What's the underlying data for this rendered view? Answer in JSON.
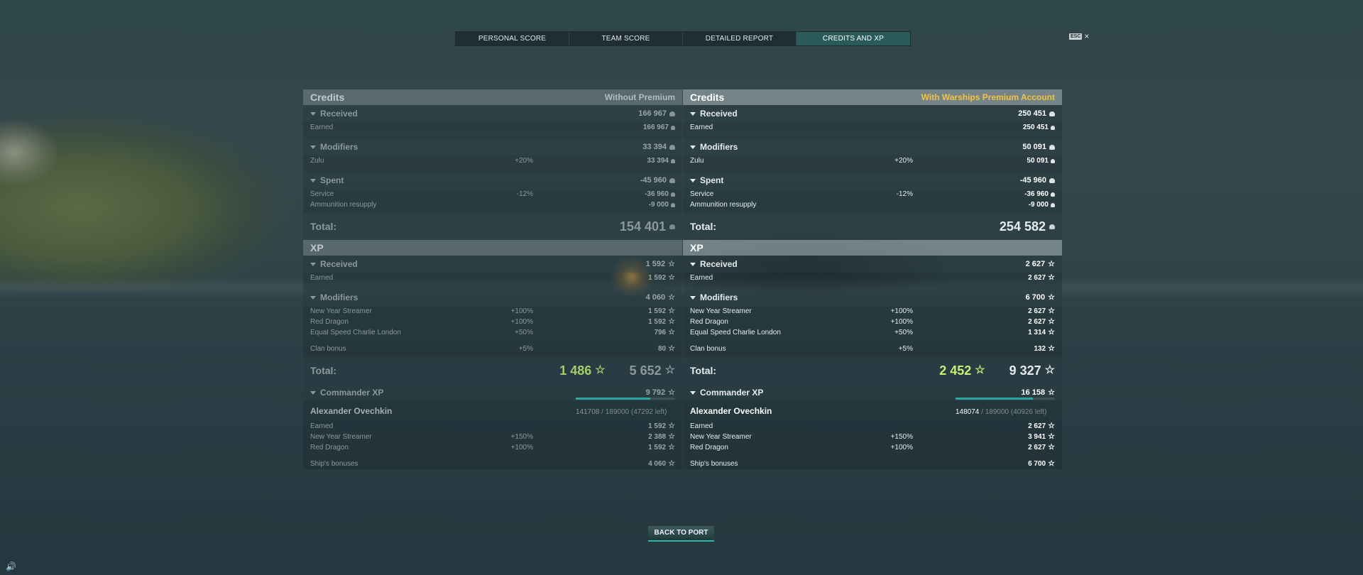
{
  "tabs": {
    "personal": "PERSONAL SCORE",
    "team": "TEAM SCORE",
    "detailed": "DETAILED REPORT",
    "credits_xp": "CREDITS AND XP"
  },
  "esc": {
    "key": "ESC",
    "close": "×"
  },
  "left": {
    "credits_title": "Credits",
    "badge": "Without Premium",
    "received": {
      "label": "Received",
      "amount": "166 967"
    },
    "earned": {
      "label": "Earned",
      "amount": "166 967"
    },
    "modifiers": {
      "label": "Modifiers",
      "amount": "33 394"
    },
    "zulu": {
      "label": "Zulu",
      "pct": "+20%",
      "amount": "33 394"
    },
    "spent": {
      "label": "Spent",
      "amount": "-45 960"
    },
    "service": {
      "label": "Service",
      "pct": "-12%",
      "amount": "-36 960"
    },
    "ammo": {
      "label": "Ammunition resupply",
      "amount": "-9 000"
    },
    "total_label": "Total:",
    "total_credits": "154 401",
    "xp_title": "XP",
    "xp_received": {
      "label": "Received",
      "amount": "1 592"
    },
    "xp_earned": {
      "label": "Earned",
      "amount": "1 592"
    },
    "xp_modifiers": {
      "label": "Modifiers",
      "amount": "4 060"
    },
    "nys": {
      "label": "New Year Streamer",
      "pct": "+100%",
      "amount": "1 592"
    },
    "rd": {
      "label": "Red Dragon",
      "pct": "+100%",
      "amount": "1 592"
    },
    "escl": {
      "label": "Equal Speed Charlie London",
      "pct": "+50%",
      "amount": "796"
    },
    "clan": {
      "label": "Clan bonus",
      "pct": "+5%",
      "amount": "80"
    },
    "xp_total_label": "Total:",
    "xp_total_free": "1 486",
    "xp_total": "5 652",
    "cmd": {
      "label": "Commander XP",
      "amount": "9 792"
    },
    "commander": {
      "name": "Alexander Ovechkin",
      "current": "141708",
      "rest": "/ 189000 (47292 left)",
      "progress": 0.75
    },
    "cmd_earned": {
      "label": "Earned",
      "amount": "1 592"
    },
    "cmd_nys": {
      "label": "New Year Streamer",
      "pct": "+150%",
      "amount": "2 388"
    },
    "cmd_rd": {
      "label": "Red Dragon",
      "pct": "+100%",
      "amount": "1 592"
    },
    "ship_bonus": {
      "label": "Ship's bonuses",
      "amount": "4 060"
    }
  },
  "right": {
    "credits_title": "Credits",
    "badge": "With Warships Premium Account",
    "received": {
      "label": "Received",
      "amount": "250 451"
    },
    "earned": {
      "label": "Earned",
      "amount": "250 451"
    },
    "modifiers": {
      "label": "Modifiers",
      "amount": "50 091"
    },
    "zulu": {
      "label": "Zulu",
      "pct": "+20%",
      "amount": "50 091"
    },
    "spent": {
      "label": "Spent",
      "amount": "-45 960"
    },
    "service": {
      "label": "Service",
      "pct": "-12%",
      "amount": "-36 960"
    },
    "ammo": {
      "label": "Ammunition resupply",
      "amount": "-9 000"
    },
    "total_label": "Total:",
    "total_credits": "254 582",
    "xp_title": "XP",
    "xp_received": {
      "label": "Received",
      "amount": "2 627"
    },
    "xp_earned": {
      "label": "Earned",
      "amount": "2 627"
    },
    "xp_modifiers": {
      "label": "Modifiers",
      "amount": "6 700"
    },
    "nys": {
      "label": "New Year Streamer",
      "pct": "+100%",
      "amount": "2 627"
    },
    "rd": {
      "label": "Red Dragon",
      "pct": "+100%",
      "amount": "2 627"
    },
    "escl": {
      "label": "Equal Speed Charlie London",
      "pct": "+50%",
      "amount": "1 314"
    },
    "clan": {
      "label": "Clan bonus",
      "pct": "+5%",
      "amount": "132"
    },
    "xp_total_label": "Total:",
    "xp_total_free": "2 452",
    "xp_total": "9 327",
    "cmd": {
      "label": "Commander XP",
      "amount": "16 158"
    },
    "commander": {
      "name": "Alexander Ovechkin",
      "current": "148074",
      "rest": "/ 189000 (40926 left)",
      "progress": 0.78
    },
    "cmd_earned": {
      "label": "Earned",
      "amount": "2 627"
    },
    "cmd_nys": {
      "label": "New Year Streamer",
      "pct": "+150%",
      "amount": "3 941"
    },
    "cmd_rd": {
      "label": "Red Dragon",
      "pct": "+100%",
      "amount": "2 627"
    },
    "ship_bonus": {
      "label": "Ship's bonuses",
      "amount": "6 700"
    }
  },
  "back_button": "BACK TO PORT",
  "icons": {
    "credit": "credit-coin-icon",
    "xp": "star-icon",
    "sound": "speaker-icon",
    "collapse": "triangle-down-icon"
  },
  "colors": {
    "active_tab": "#2a5a5a",
    "premium_badge": "#f2c33c",
    "free_xp_green": "#c8f070",
    "button_accent": "#2fb5a6"
  }
}
